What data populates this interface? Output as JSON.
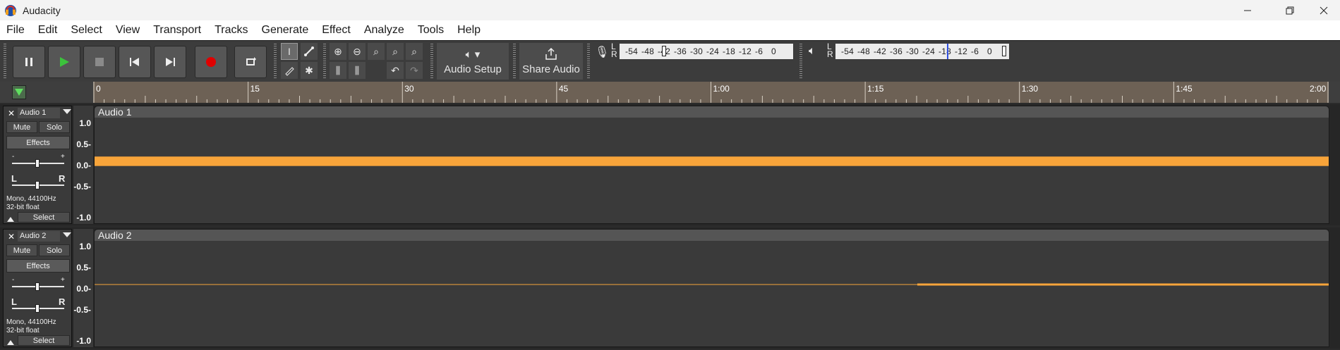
{
  "window": {
    "title": "Audacity"
  },
  "menu": [
    "File",
    "Edit",
    "Select",
    "View",
    "Transport",
    "Tracks",
    "Generate",
    "Effect",
    "Analyze",
    "Tools",
    "Help"
  ],
  "toolbar": {
    "audio_setup_label": "Audio Setup",
    "share_audio_label": "Share Audio",
    "record_meter": {
      "channels": "L\nR",
      "scale": [
        "-54",
        "-48",
        "-42",
        "-36",
        "-30",
        "-24",
        "-18",
        "-12",
        "-6",
        "0"
      ]
    },
    "play_meter": {
      "channels": "L\nR",
      "scale": [
        "-54",
        "-48",
        "-42",
        "-36",
        "-30",
        "-24",
        "-18",
        "-12",
        "-6",
        "0"
      ]
    }
  },
  "timeline": {
    "ticks": [
      {
        "label": "0",
        "t": 0
      },
      {
        "label": "15",
        "t": 15
      },
      {
        "label": "30",
        "t": 30
      },
      {
        "label": "45",
        "t": 45
      },
      {
        "label": "1:00",
        "t": 60
      },
      {
        "label": "1:15",
        "t": 75
      },
      {
        "label": "1:30",
        "t": 90
      },
      {
        "label": "1:45",
        "t": 105
      },
      {
        "label": "2:00",
        "t": 120
      }
    ],
    "max_seconds": 120
  },
  "tracks": [
    {
      "name": "Audio 1",
      "clip_name": "Audio 1",
      "mute_label": "Mute",
      "solo_label": "Solo",
      "effects_label": "Effects",
      "select_label": "Select",
      "info": "Mono, 44100Hz\n32-bit float",
      "gain_minus": "-",
      "gain_plus": "+",
      "pan_left": "L",
      "pan_right": "R",
      "vruler": [
        "1.0",
        "0.5-",
        "0.0-",
        "-0.5-",
        "-1.0"
      ],
      "waveform_amplitude": 0.1,
      "waveform_start_seconds": 0
    },
    {
      "name": "Audio 2",
      "clip_name": "Audio 2",
      "mute_label": "Mute",
      "solo_label": "Solo",
      "effects_label": "Effects",
      "select_label": "Select",
      "info": "Mono, 44100Hz\n32-bit float",
      "gain_minus": "-",
      "gain_plus": "+",
      "pan_left": "L",
      "pan_right": "R",
      "vruler": [
        "1.0",
        "0.5-",
        "0.0-",
        "-0.5-",
        "-1.0"
      ],
      "waveform_amplitude": 0.01,
      "waveform_thick_from_seconds": 80
    }
  ],
  "colors": {
    "waveform": "#f7a43a",
    "record_button": "#e00000",
    "play_button": "#3cc23c"
  }
}
